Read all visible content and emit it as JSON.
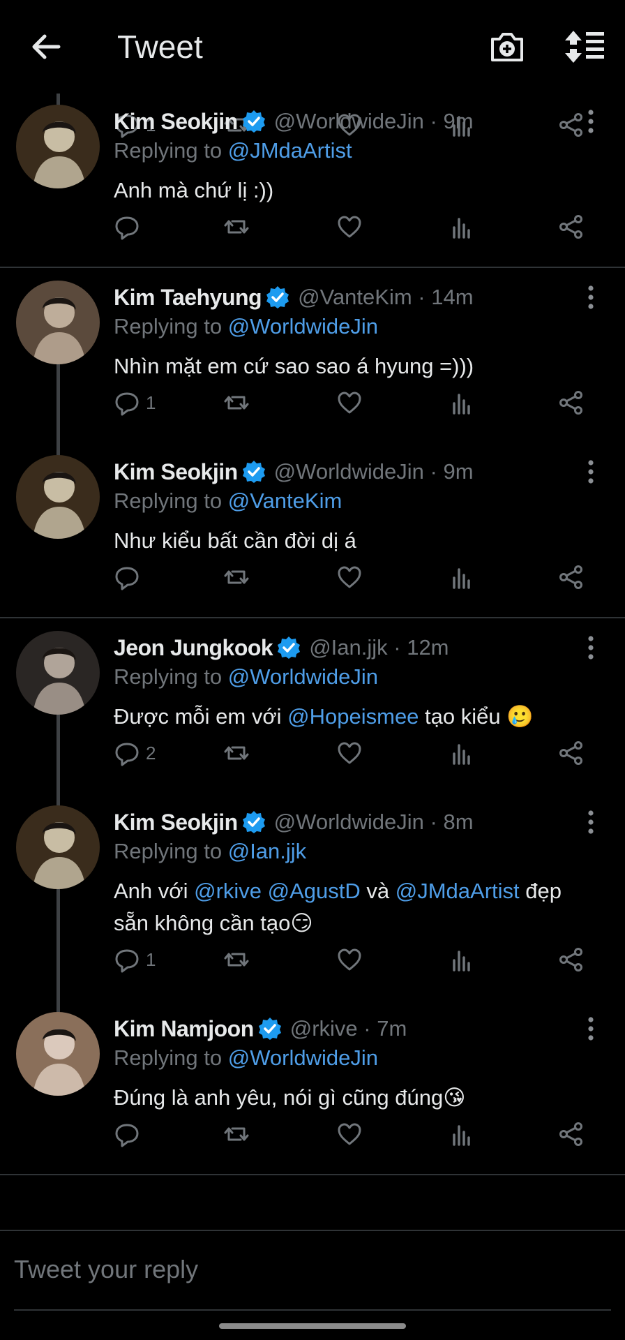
{
  "header": {
    "title": "Tweet",
    "back_icon": "arrow-left-icon",
    "camera_icon": "camera-add-icon",
    "sort_icon": "sort-icon"
  },
  "colors": {
    "background": "#000000",
    "text": "#e7e9ea",
    "muted": "#71767b",
    "link": "#4f9ee8",
    "verified": "#1d9bf0"
  },
  "top_actions": {
    "reply_count": "1"
  },
  "tweets": [
    {
      "name": "Kim Seokjin",
      "handle": "@WorldwideJin · 9m",
      "replying_label": "Replying to",
      "replying_to": "@JMdaArtist",
      "text": [
        {
          "t": "Anh mà chứ lị :))"
        }
      ],
      "reply_count": ""
    },
    {
      "name": "Kim Taehyung",
      "handle": "@VanteKim · 14m",
      "replying_label": "Replying to",
      "replying_to": "@WorldwideJin",
      "text": [
        {
          "t": "Nhìn mặt em cứ sao sao á hyung =)))"
        }
      ],
      "reply_count": "1"
    },
    {
      "name": "Kim Seokjin",
      "handle": "@WorldwideJin · 9m",
      "replying_label": "Replying to",
      "replying_to": "@VanteKim",
      "text": [
        {
          "t": "Như kiểu bất cần đời dị á"
        }
      ],
      "reply_count": ""
    },
    {
      "name": "Jeon Jungkook",
      "handle": "@Ian.jjk · 12m",
      "replying_label": "Replying to",
      "replying_to": "@WorldwideJin",
      "text": [
        {
          "t": "Được mỗi em với "
        },
        {
          "t": "@Hopeismee",
          "m": true
        },
        {
          "t": " tạo kiểu 🥲"
        }
      ],
      "reply_count": "2"
    },
    {
      "name": "Kim Seokjin",
      "handle": "@WorldwideJin · 8m",
      "replying_label": "Replying to",
      "replying_to": "@Ian.jjk",
      "text": [
        {
          "t": "Anh với "
        },
        {
          "t": "@rkive",
          "m": true
        },
        {
          "t": " "
        },
        {
          "t": "@AgustD",
          "m": true
        },
        {
          "t": " và "
        },
        {
          "t": "@JMdaArtist",
          "m": true
        },
        {
          "t": " đẹp sẵn không cần tạo😏"
        }
      ],
      "reply_count": "1"
    },
    {
      "name": "Kim Namjoon",
      "handle": "@rkive · 7m",
      "replying_label": "Replying to",
      "replying_to": "@WorldwideJin",
      "text": [
        {
          "t": "Đúng là anh yêu, nói gì cũng đúng😘"
        }
      ],
      "reply_count": ""
    }
  ],
  "reply_placeholder": "Tweet your reply"
}
